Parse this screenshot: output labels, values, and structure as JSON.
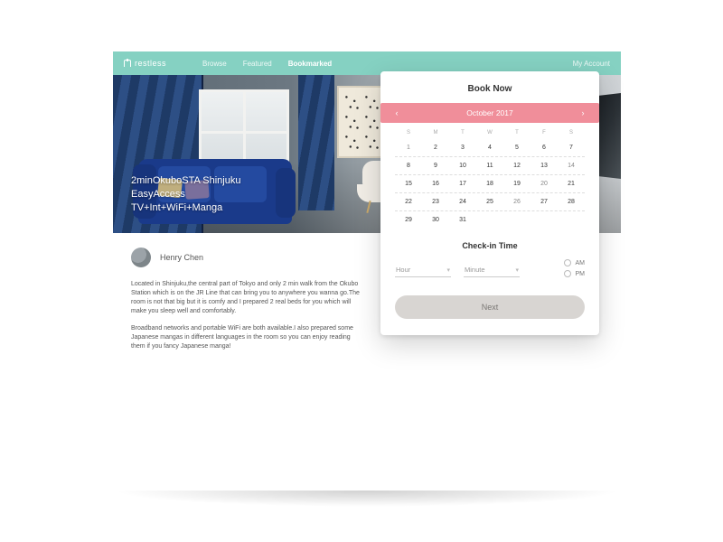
{
  "nav": {
    "brand": "restless",
    "links": [
      "Browse",
      "Featured",
      "Bookmarked"
    ],
    "active_index": 2,
    "account": "My Account"
  },
  "hero": {
    "title_line1": "2minOkuboSTA Shinjuku",
    "title_line2": "EasyAccess",
    "title_line3": "TV+Int+WiFi+Manga"
  },
  "author": {
    "name": "Henry Chen"
  },
  "description": {
    "p1": "Located in Shinjuku,the central part of Tokyo and only 2 min walk from the Okubo Station which is on the JR Line that can bring you to anywhere you wanna go.The room is not that big but it is comfy and I prepared 2 real beds for you which will make you sleep well and comfortably.",
    "p2": "Broadband networks and portable WiFi are both available.I also prepared some Japanese mangas in different languages in the room so you can enjoy reading them if you fancy Japanese manga!"
  },
  "booking": {
    "title": "Book Now",
    "month_label": "October 2017",
    "dow": [
      "S",
      "M",
      "T",
      "W",
      "T",
      "F",
      "S"
    ],
    "weeks": [
      [
        1,
        2,
        3,
        4,
        5,
        6,
        7
      ],
      [
        8,
        9,
        10,
        11,
        12,
        13,
        14
      ],
      [
        15,
        16,
        17,
        18,
        19,
        20,
        21
      ],
      [
        22,
        23,
        24,
        25,
        26,
        27,
        28
      ],
      [
        29,
        30,
        31
      ]
    ],
    "checkin_title": "Check-in Time",
    "hour_placeholder": "Hour",
    "minute_placeholder": "Minute",
    "ampm": {
      "am": "AM",
      "pm": "PM"
    },
    "next": "Next"
  }
}
